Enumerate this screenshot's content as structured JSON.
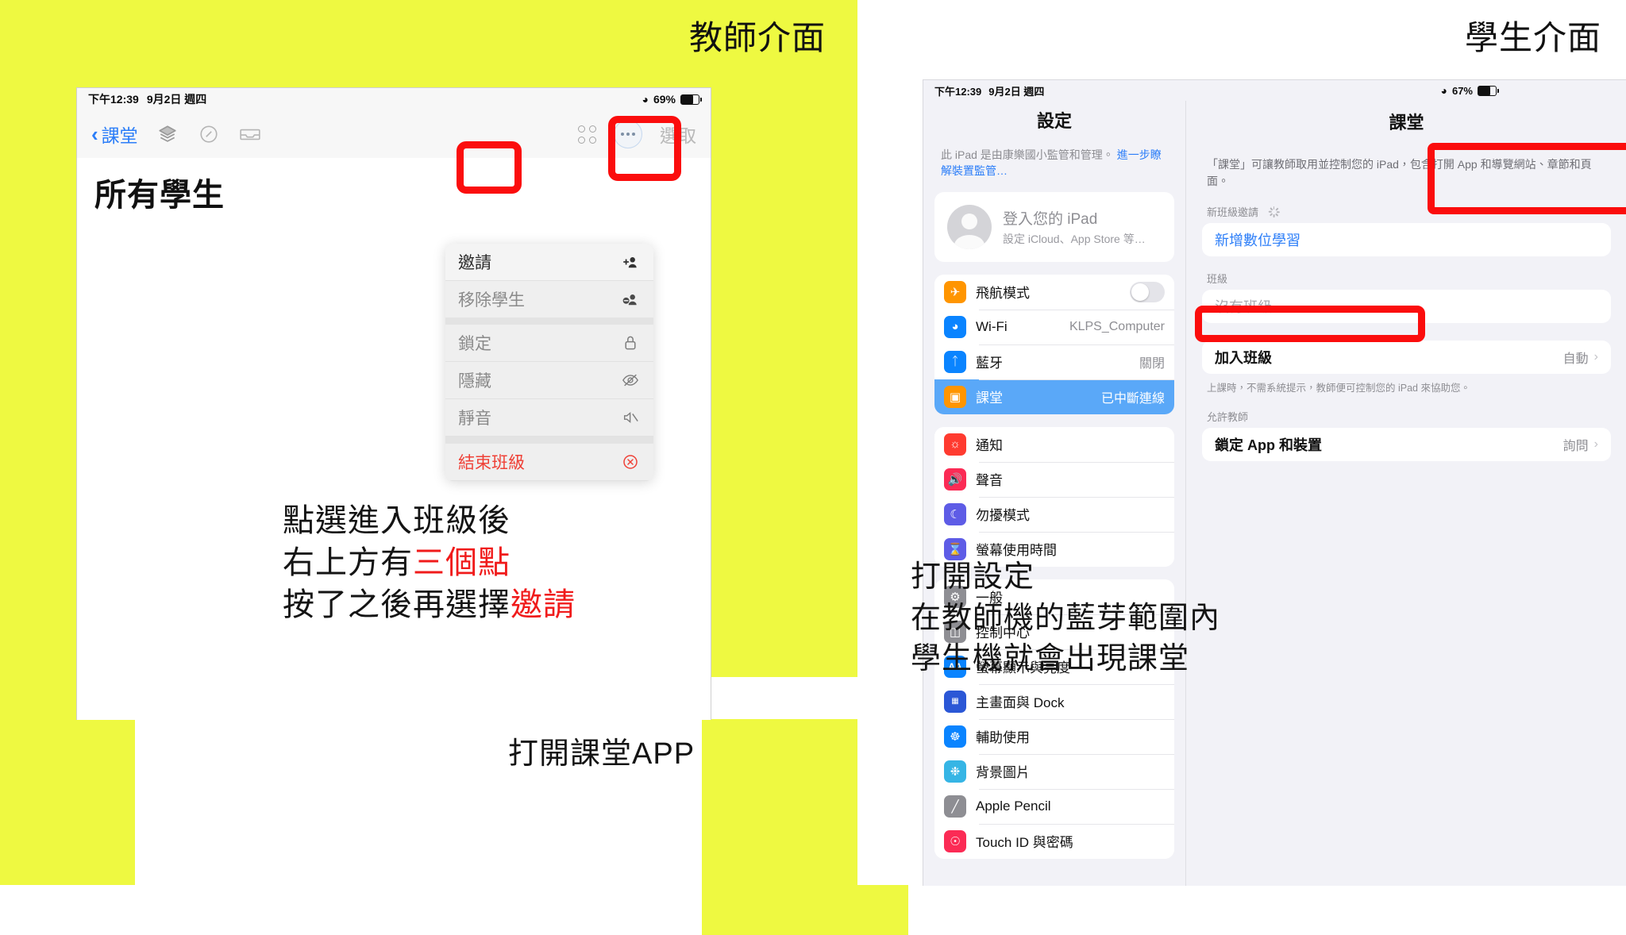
{
  "slide": {
    "teacher_header": "教師介面",
    "student_header": "學生介面"
  },
  "teacher": {
    "statusbar": {
      "time": "下午12:39",
      "date": "9月2日 週四",
      "wifi_icon": "wifi-icon",
      "battery_percent": "69%"
    },
    "navbar": {
      "back_label": "課堂",
      "back_chevron": "chevron-left-icon",
      "icon_layers": "layers-icon",
      "icon_compass": "compass-icon",
      "icon_tray": "tray-icon",
      "icon_grid": "grid-icon",
      "icon_ellipsis": "ellipsis-circle-icon",
      "select_label": "選取"
    },
    "page_title": "所有學生",
    "menu": [
      {
        "label": "邀請",
        "icon": "person-badge-plus-icon",
        "style": "first"
      },
      {
        "label": "移除學生",
        "icon": "person-badge-minus-icon",
        "style": "normal"
      },
      {
        "label": "鎖定",
        "icon": "lock-icon",
        "style": "normal"
      },
      {
        "label": "隱藏",
        "icon": "eye-slash-icon",
        "style": "normal"
      },
      {
        "label": "靜音",
        "icon": "speaker-slash-icon",
        "style": "normal"
      },
      {
        "label": "結束班級",
        "icon": "xmark-circle-icon",
        "style": "danger"
      }
    ],
    "annotation": {
      "line1": "點選進入班級後",
      "line2_a": "右上方有",
      "line2_hl": "三個點",
      "line3_a": "按了之後再選擇",
      "line3_hl": "邀請"
    },
    "annotation_open_app": "打開課堂APP"
  },
  "student": {
    "statusbar": {
      "time": "下午12:39",
      "date": "9月2日 週四",
      "wifi_icon": "wifi-icon",
      "battery_percent": "67%"
    },
    "settings_title": "設定",
    "supervision": {
      "text": "此 iPad 是由康樂國小監管和管理。",
      "link": "進一步瞭解裝置監管…"
    },
    "account": {
      "title": "登入您的 iPad",
      "subtitle": "設定 iCloud、App Store 等…",
      "avatar_icon": "person-circle-icon"
    },
    "group1": [
      {
        "label": "飛航模式",
        "value": "",
        "icon": "airplane-icon",
        "color": "#ff9500",
        "type": "toggle",
        "on": false
      },
      {
        "label": "Wi-Fi",
        "value": "KLPS_Computer",
        "icon": "wifi-icon",
        "color": "#0a84ff",
        "type": "value"
      },
      {
        "label": "藍牙",
        "value": "關閉",
        "icon": "bluetooth-icon",
        "color": "#0a84ff",
        "type": "value"
      },
      {
        "label": "課堂",
        "value": "已中斷連線",
        "icon": "classroom-icon",
        "color": "#ff9500",
        "type": "value",
        "selected": true
      }
    ],
    "group2": [
      {
        "label": "通知",
        "value": "",
        "icon": "bell-icon",
        "color": "#ff3b30"
      },
      {
        "label": "聲音",
        "value": "",
        "icon": "speaker-icon",
        "color": "#fb2b55"
      },
      {
        "label": "勿擾模式",
        "value": "",
        "icon": "moon-icon",
        "color": "#5e5ce6"
      },
      {
        "label": "螢幕使用時間",
        "value": "",
        "icon": "hourglass-icon",
        "color": "#5e5ce6"
      }
    ],
    "group3": [
      {
        "label": "一般",
        "value": "",
        "icon": "gear-icon",
        "color": "#8e8e93"
      },
      {
        "label": "控制中心",
        "value": "",
        "icon": "sliders-icon",
        "color": "#8e8e93"
      },
      {
        "label": "螢幕顯示與亮度",
        "value": "",
        "icon": "text-size-icon",
        "color": "#0a84ff"
      },
      {
        "label": "主畫面與 Dock",
        "value": "",
        "icon": "home-screen-icon",
        "color": "#2b57d6"
      },
      {
        "label": "輔助使用",
        "value": "",
        "icon": "accessibility-icon",
        "color": "#0a84ff"
      },
      {
        "label": "背景圖片",
        "value": "",
        "icon": "wallpaper-icon",
        "color": "#36b5e5"
      },
      {
        "label": "Apple Pencil",
        "value": "",
        "icon": "pencil-icon",
        "color": "#8e8e93"
      },
      {
        "label": "Touch ID 與密碼",
        "value": "",
        "icon": "fingerprint-icon",
        "color": "#fb2b55"
      }
    ],
    "detail": {
      "title": "課堂",
      "description": "「課堂」可讓教師取用並控制您的 iPad，包含打開 App 和導覽網站、章節和頁面。",
      "invite_section_header": "新班級邀請",
      "invite_item": "新增數位學習",
      "class_section_header": "班級",
      "class_empty": "沒有班級",
      "join_label": "加入班級",
      "join_value": "自動",
      "join_footnote": "上課時，不需系統提示，教師便可控制您的 iPad 來協助您。",
      "allow_section_header": "允許教師",
      "lock_label": "鎖定 App 和裝置",
      "lock_value": "詢問",
      "chevron": "chevron-right-icon"
    },
    "annotation": {
      "line1": "打開設定",
      "line2": "在教師機的藍芽範圍內",
      "line3": "學生機就會出現課堂"
    }
  },
  "colors": {
    "slide_background": "#eef941",
    "highlight_red": "#fb0d0d",
    "accent_blue": "#2c7ef8",
    "selected_row_blue": "#5aa8f8",
    "danger_red": "#ef4036"
  }
}
